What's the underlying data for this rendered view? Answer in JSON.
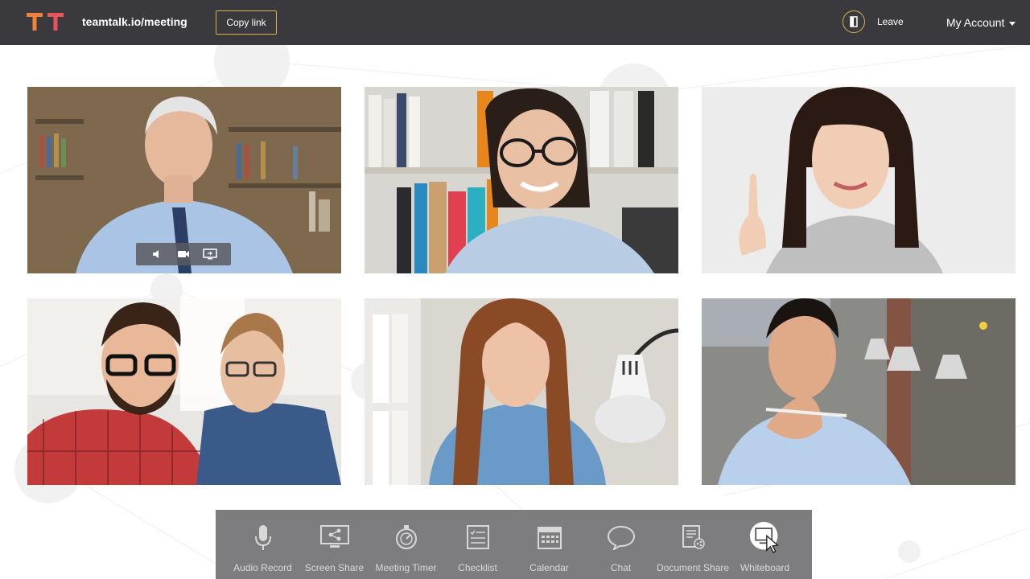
{
  "header": {
    "logo_text": "TT",
    "meeting_url": "teamtalk.io/meeting",
    "copy_label": "Copy link",
    "leave_label": "Leave",
    "account_label": "My Account"
  },
  "tiles": [
    {
      "description": "participant-older-man"
    },
    {
      "description": "participant-woman-glasses"
    },
    {
      "description": "participant-woman-pointing"
    },
    {
      "description": "participant-two-men"
    },
    {
      "description": "participant-woman-reading"
    },
    {
      "description": "participant-man-thinking"
    }
  ],
  "tile_controls": [
    "speaker-icon",
    "camera-icon",
    "screen-share-icon"
  ],
  "toolbar": {
    "items": [
      {
        "label": "Audio Record",
        "icon": "microphone-icon"
      },
      {
        "label": "Screen Share",
        "icon": "screen-share-icon"
      },
      {
        "label": "Meeting Timer",
        "icon": "timer-icon"
      },
      {
        "label": "Checklist",
        "icon": "checklist-icon"
      },
      {
        "label": "Calendar",
        "icon": "calendar-icon"
      },
      {
        "label": "Chat",
        "icon": "chat-icon"
      },
      {
        "label": "Document Share",
        "icon": "document-share-icon"
      },
      {
        "label": "Whiteboard",
        "icon": "whiteboard-icon"
      }
    ]
  },
  "colors": {
    "header_bg": "#3a3a3e",
    "accent_gold": "#d8b24a",
    "logo_orange": "#f0813a",
    "logo_red": "#e8545a",
    "toolbar_bg": "#7d7d7f"
  }
}
